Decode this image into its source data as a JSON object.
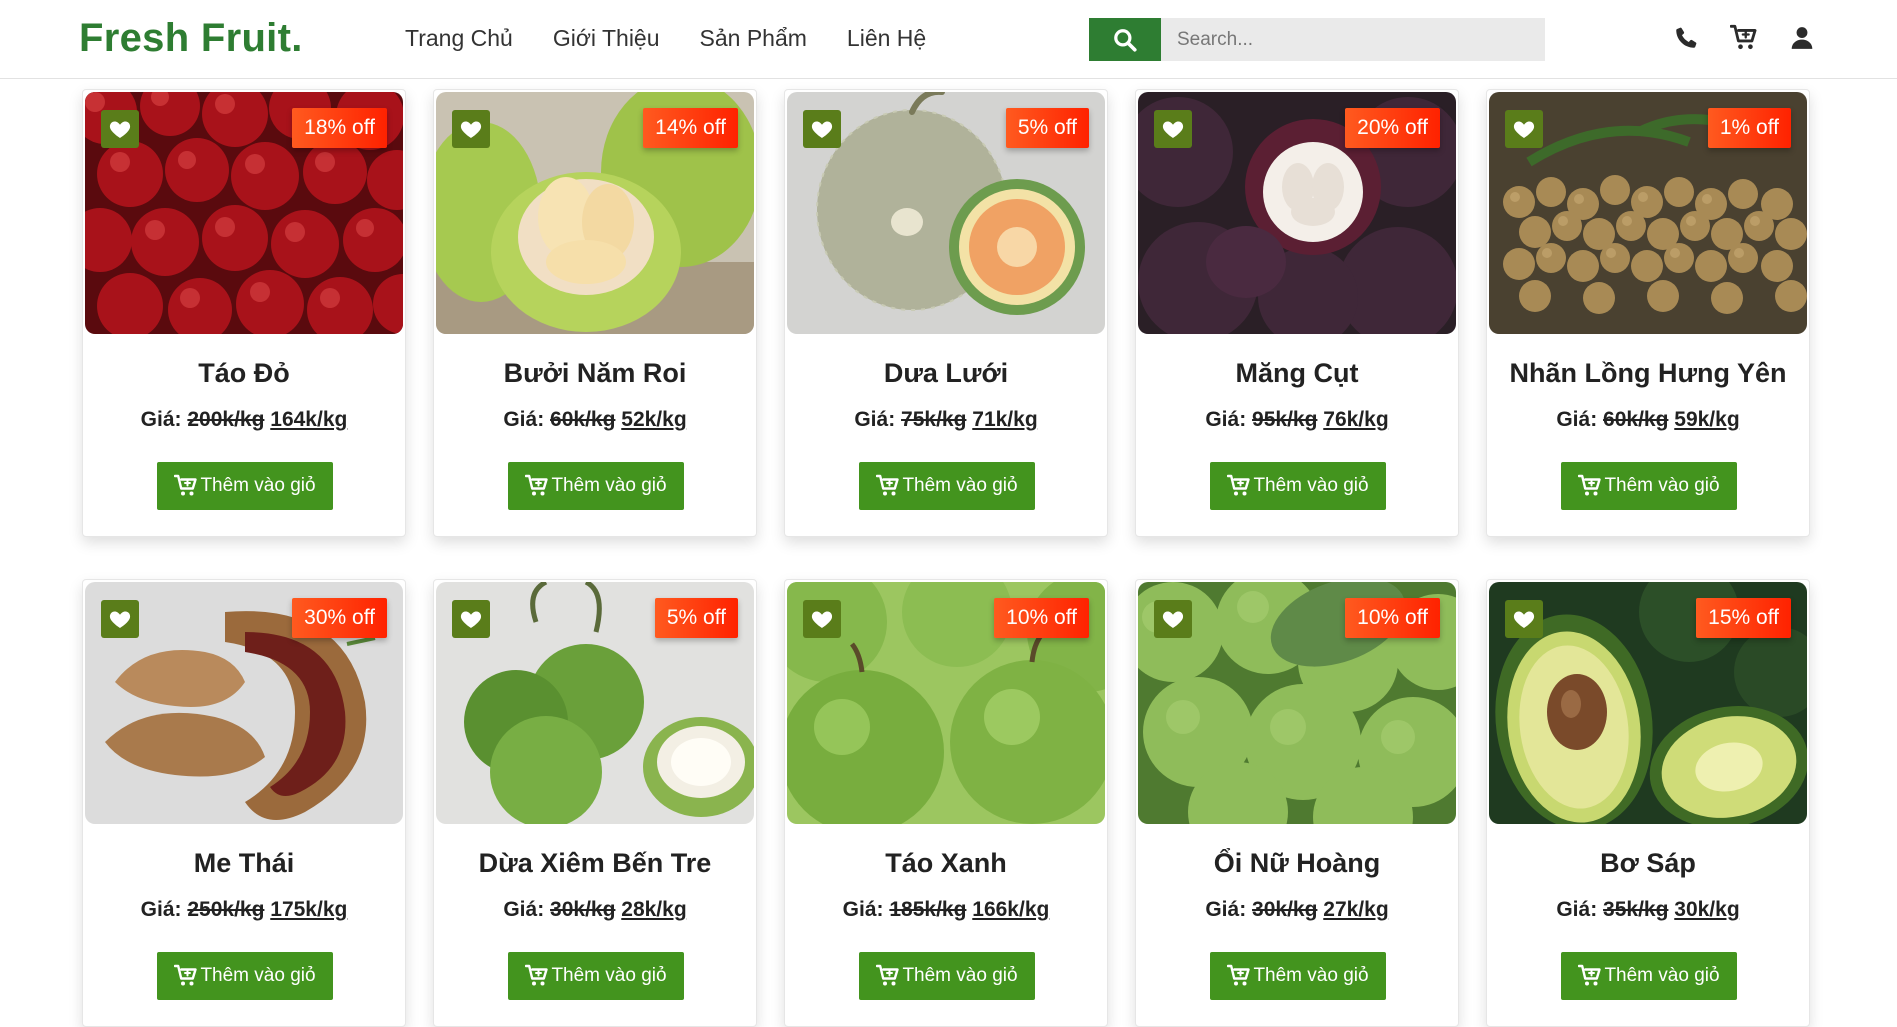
{
  "header": {
    "logo": "Fresh Fruit.",
    "nav": [
      "Trang Chủ",
      "Giới Thiệu",
      "Sản Phẩm",
      "Liên Hệ"
    ],
    "search_placeholder": "Search...",
    "icons": [
      "phone-icon",
      "cart-icon",
      "user-icon"
    ]
  },
  "labels": {
    "price_prefix": "Giá:",
    "add_to_cart": "Thêm vào giỏ"
  },
  "colors": {
    "brand_green": "#2e7d32",
    "button_green": "#43941e",
    "heart_bg": "#5a7d1a",
    "discount_red": "#ff2200"
  },
  "products": [
    {
      "name": "Táo Đỏ",
      "discount": "18% off",
      "old_price": "200k/kg",
      "new_price": "164k/kg"
    },
    {
      "name": "Bưởi Năm Roi",
      "discount": "14% off",
      "old_price": "60k/kg",
      "new_price": "52k/kg"
    },
    {
      "name": "Dưa Lưới",
      "discount": "5% off",
      "old_price": "75k/kg",
      "new_price": "71k/kg"
    },
    {
      "name": "Măng Cụt",
      "discount": "20% off",
      "old_price": "95k/kg",
      "new_price": "76k/kg"
    },
    {
      "name": "Nhãn Lồng Hưng Yên",
      "discount": "1% off",
      "old_price": "60k/kg",
      "new_price": "59k/kg"
    },
    {
      "name": "Me Thái",
      "discount": "30% off",
      "old_price": "250k/kg",
      "new_price": "175k/kg"
    },
    {
      "name": "Dừa Xiêm Bến Tre",
      "discount": "5% off",
      "old_price": "30k/kg",
      "new_price": "28k/kg"
    },
    {
      "name": "Táo Xanh",
      "discount": "10% off",
      "old_price": "185k/kg",
      "new_price": "166k/kg"
    },
    {
      "name": "Ổi Nữ Hoàng",
      "discount": "10% off",
      "old_price": "30k/kg",
      "new_price": "27k/kg"
    },
    {
      "name": "Bơ Sáp",
      "discount": "15% off",
      "old_price": "35k/kg",
      "new_price": "30k/kg"
    }
  ]
}
